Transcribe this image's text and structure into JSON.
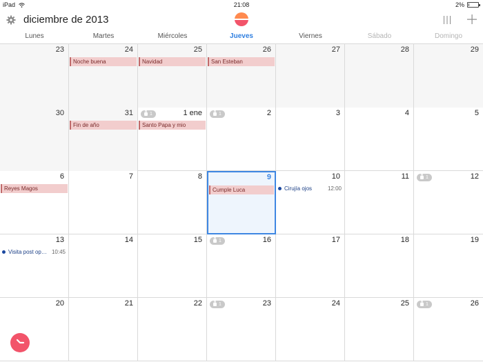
{
  "status": {
    "device": "iPad",
    "time": "21:08",
    "battery": "2%",
    "battery_level": 0.02
  },
  "header": {
    "title": "diciembre de 2013"
  },
  "weekdays": [
    "Lunes",
    "Martes",
    "Miércoles",
    "Jueves",
    "Viernes",
    "Sábado",
    "Domingo"
  ],
  "today_column": 3,
  "weeks": [
    {
      "days": [
        {
          "num": "23",
          "past": true
        },
        {
          "num": "24",
          "past": true,
          "allday": "Noche buena"
        },
        {
          "num": "25",
          "past": true,
          "allday": "Navidad"
        },
        {
          "num": "26",
          "past": true,
          "allday": "San Esteban"
        },
        {
          "num": "27",
          "past": true
        },
        {
          "num": "28",
          "past": true
        },
        {
          "num": "29",
          "past": true
        }
      ]
    },
    {
      "days": [
        {
          "num": "30",
          "past": true
        },
        {
          "num": "31",
          "past": true,
          "allday": "Fin de año"
        },
        {
          "num": "1 ene",
          "badge": "1",
          "allday": "Santo Papa y mio"
        },
        {
          "num": "2",
          "badge": "1"
        },
        {
          "num": "3"
        },
        {
          "num": "4"
        },
        {
          "num": "5"
        }
      ]
    },
    {
      "days": [
        {
          "num": "6",
          "allday": "Reyes Magos"
        },
        {
          "num": "7"
        },
        {
          "num": "8"
        },
        {
          "num": "9",
          "selected": true,
          "allday": "Cumple Luca"
        },
        {
          "num": "10",
          "timed": {
            "title": "Cirujía ojos",
            "time": "12:00"
          }
        },
        {
          "num": "11"
        },
        {
          "num": "12",
          "badge": "1"
        }
      ]
    },
    {
      "days": [
        {
          "num": "13",
          "timed": {
            "title": "Visita post oper...",
            "time": "10:45"
          }
        },
        {
          "num": "14"
        },
        {
          "num": "15"
        },
        {
          "num": "16",
          "badge": "1"
        },
        {
          "num": "17"
        },
        {
          "num": "18"
        },
        {
          "num": "19"
        }
      ]
    },
    {
      "days": [
        {
          "num": "20"
        },
        {
          "num": "21"
        },
        {
          "num": "22"
        },
        {
          "num": "23",
          "badge": "1"
        },
        {
          "num": "24"
        },
        {
          "num": "25"
        },
        {
          "num": "26",
          "badge": "1"
        }
      ]
    }
  ],
  "icons": {
    "settings": "gear-icon",
    "logo": "sunrise-logo-icon",
    "view_toggle": "columns-icon",
    "add": "plus-icon",
    "fab": "clock-icon",
    "badge": "lock-icon"
  },
  "colors": {
    "accent": "#3d86e2",
    "allday_bg": "#f2cdcd",
    "fab": "#f2546a",
    "timed_dot": "#1b48a0"
  }
}
